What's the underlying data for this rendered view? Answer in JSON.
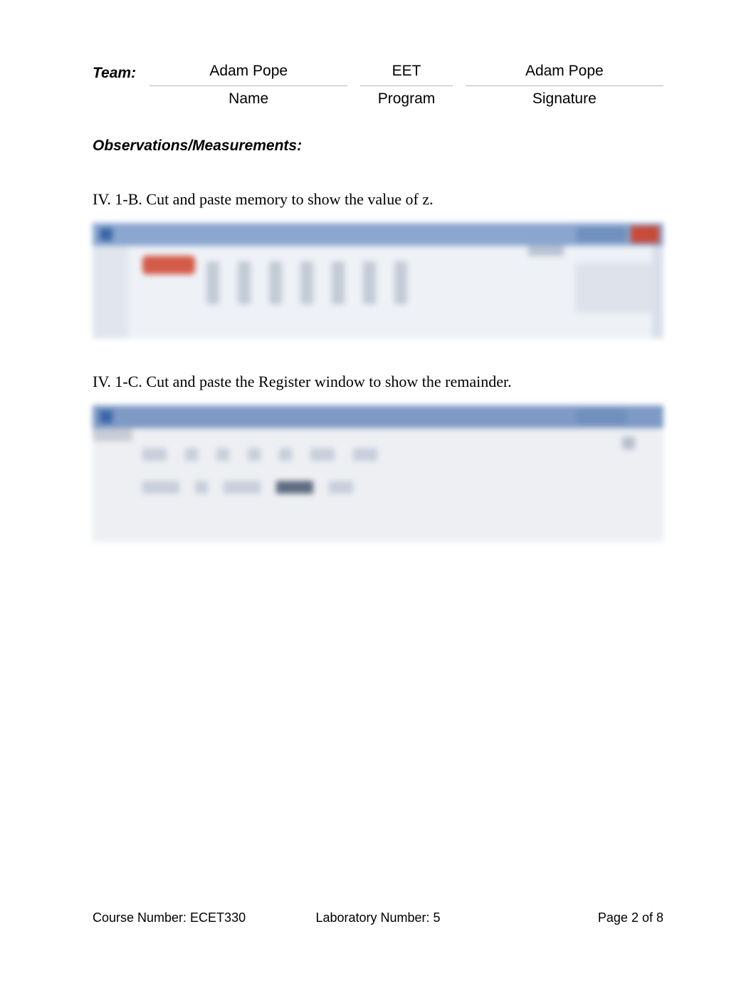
{
  "team": {
    "label": "Team:",
    "columns": {
      "name": {
        "value": "Adam Pope",
        "header": "Name"
      },
      "program": {
        "value": "EET",
        "header": "Program"
      },
      "signature": {
        "value": "Adam Pope",
        "header": "Signature"
      }
    }
  },
  "section_heading": "Observations/Measurements:",
  "tasks": {
    "b": {
      "number": "IV. 1-B.",
      "text": "Cut and paste memory to show the value of z."
    },
    "c": {
      "number": "IV. 1-C.",
      "text": "Cut and paste the Register window to show the remainder."
    }
  },
  "footer": {
    "course": "Course Number: ECET330",
    "lab": "Laboratory Number: 5",
    "page": "Page 2 of 8"
  }
}
